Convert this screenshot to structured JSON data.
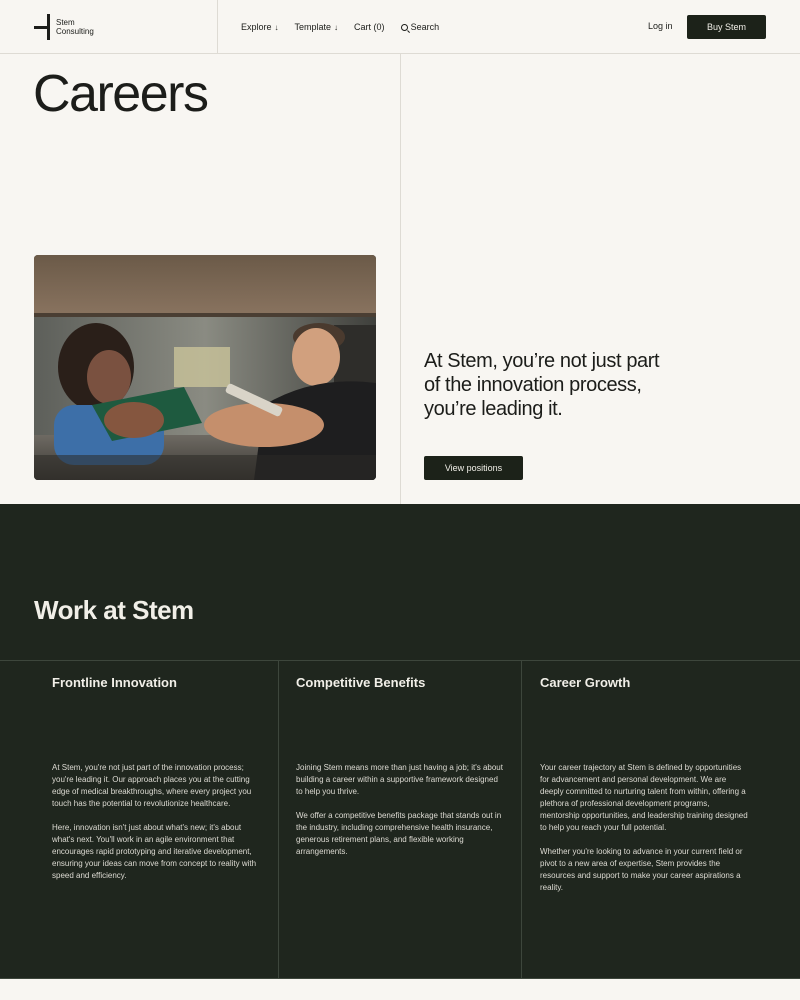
{
  "header": {
    "logo_line1": "Stem",
    "logo_line2": "Consulting",
    "nav": {
      "explore": "Explore",
      "template": "Template",
      "cart": "Cart (0)",
      "search": "Search"
    },
    "login": "Log in",
    "buy": "Buy Stem"
  },
  "hero": {
    "title": "Careers",
    "tagline": "At Stem, you’re not just part of the innovation process, you’re leading it.",
    "cta": "View positions"
  },
  "work": {
    "title": "Work at Stem",
    "columns": [
      {
        "title": "Frontline Innovation",
        "paragraphs": [
          "At Stem, you're not just part of the innovation process; you're leading it. Our approach places you at the cutting edge of medical breakthroughs, where every project you touch has the potential to revolutionize healthcare.",
          "Here, innovation isn't just about what's new; it's about what's next. You'll work in an agile environment that encourages rapid prototyping and iterative development, ensuring your ideas can move from concept to reality with speed and efficiency."
        ]
      },
      {
        "title": "Competitive Benefits",
        "paragraphs": [
          "Joining Stem means more than just having a job; it's about building a career within a supportive framework designed to help you thrive.",
          "We offer a competitive benefits package that stands out in the industry, including comprehensive health insurance, generous retirement plans, and flexible working arrangements."
        ]
      },
      {
        "title": "Career Growth",
        "paragraphs": [
          "Your career trajectory at Stem is defined by opportunities for advancement and personal development. We are deeply committed to nurturing talent from within, offering a plethora of professional development programs, mentorship opportunities, and leadership training designed to help you reach your full potential.",
          "Whether you're looking to advance in your current field or pivot to a new area of expertise, Stem provides the resources and support to make your career aspirations a reality."
        ]
      }
    ]
  },
  "colors": {
    "background": "#f8f6f2",
    "dark": "#1f261e",
    "button": "#1c2219",
    "text": "#1c1d1a"
  }
}
